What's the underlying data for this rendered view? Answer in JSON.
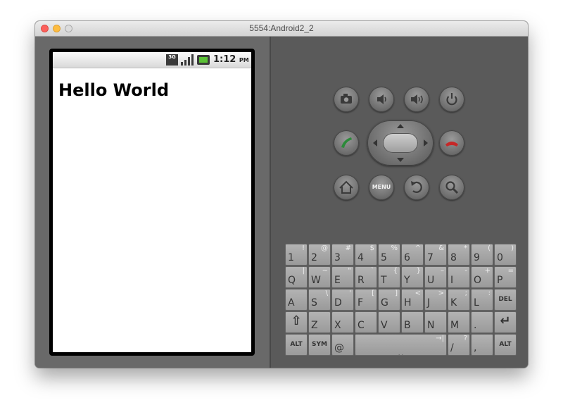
{
  "window": {
    "title": "5554:Android2_2"
  },
  "status_bar": {
    "network": "3G",
    "time": "1:12",
    "ampm": "PM"
  },
  "app": {
    "text": "Hello World"
  },
  "controls": {
    "menu_label": "MENU"
  },
  "keyboard": {
    "rows": [
      [
        {
          "m": "1",
          "s": "!"
        },
        {
          "m": "2",
          "s": "@"
        },
        {
          "m": "3",
          "s": "#"
        },
        {
          "m": "4",
          "s": "$"
        },
        {
          "m": "5",
          "s": "%"
        },
        {
          "m": "6",
          "s": "^"
        },
        {
          "m": "7",
          "s": "&"
        },
        {
          "m": "8",
          "s": "*"
        },
        {
          "m": "9",
          "s": "("
        },
        {
          "m": "0",
          "s": ")"
        }
      ],
      [
        {
          "m": "Q",
          "s": "|"
        },
        {
          "m": "W",
          "s": "~"
        },
        {
          "m": "E",
          "s": "\""
        },
        {
          "m": "R",
          "s": "`"
        },
        {
          "m": "T",
          "s": "{"
        },
        {
          "m": "Y",
          "s": "}"
        },
        {
          "m": "U",
          "s": "–"
        },
        {
          "m": "I",
          "s": "-"
        },
        {
          "m": "O",
          "s": "+"
        },
        {
          "m": "P",
          "s": "="
        }
      ],
      [
        {
          "m": "A",
          "s": ""
        },
        {
          "m": "S",
          "s": "\\"
        },
        {
          "m": "D",
          "s": "'"
        },
        {
          "m": "F",
          "s": "["
        },
        {
          "m": "G",
          "s": "]"
        },
        {
          "m": "H",
          "s": "<"
        },
        {
          "m": "J",
          "s": ">"
        },
        {
          "m": "K",
          "s": ";"
        },
        {
          "m": "L",
          "s": ":"
        },
        {
          "m": "DEL",
          "s": ""
        }
      ],
      [
        {
          "m": "⇧",
          "s": ""
        },
        {
          "m": "Z",
          "s": ""
        },
        {
          "m": "X",
          "s": ""
        },
        {
          "m": "C",
          "s": ""
        },
        {
          "m": "V",
          "s": ""
        },
        {
          "m": "B",
          "s": ""
        },
        {
          "m": "N",
          "s": ""
        },
        {
          "m": "M",
          "s": ""
        },
        {
          "m": ".",
          "s": ""
        },
        {
          "m": "↵",
          "s": ""
        }
      ],
      [
        {
          "m": "ALT",
          "s": ""
        },
        {
          "m": "SYM",
          "s": ""
        },
        {
          "m": "@",
          "s": ""
        },
        {
          "m": "",
          "s": "→|"
        },
        {
          "m": "/",
          "s": "?"
        },
        {
          "m": ",",
          "s": ""
        },
        {
          "m": "ALT",
          "s": ""
        }
      ]
    ]
  },
  "colors": {
    "call_green": "#2c8a3a",
    "end_red": "#c62828",
    "battery_green": "#5bc236"
  }
}
